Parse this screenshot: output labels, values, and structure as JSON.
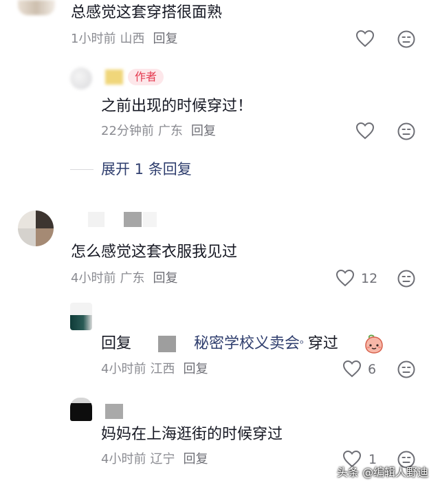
{
  "comments": [
    {
      "text": "总感觉这套穿搭很面熟",
      "time": "1小时前",
      "location": "山西",
      "reply_label": "回复"
    },
    {
      "author_tag": "作者",
      "text": "之前出现的时候穿过！",
      "time": "22分钟前",
      "location": "广东",
      "reply_label": "回复"
    },
    {
      "expand_label": "展开 1 条回复"
    },
    {
      "text": "怎么感觉这套衣服我见过",
      "time": "4小时前",
      "location": "广东",
      "reply_label": "回复",
      "like_count": "12"
    },
    {
      "reply_prefix": "回复",
      "mention": "秘密学校义卖会",
      "mention_suffix": "ᵒ",
      "text": "穿过",
      "emoji": "peach-face-emoji",
      "time": "4小时前",
      "location": "江西",
      "reply_label": "回复",
      "like_count": "6"
    },
    {
      "text": "妈妈在上海逛街的时候穿过",
      "time": "4小时前",
      "location": "辽宁",
      "reply_label": "回复",
      "like_count": "1"
    }
  ],
  "watermark": "头条 @编辑人野迪",
  "icons": {
    "like": "heart-outline-icon",
    "dislike": "neutral-face-icon"
  }
}
